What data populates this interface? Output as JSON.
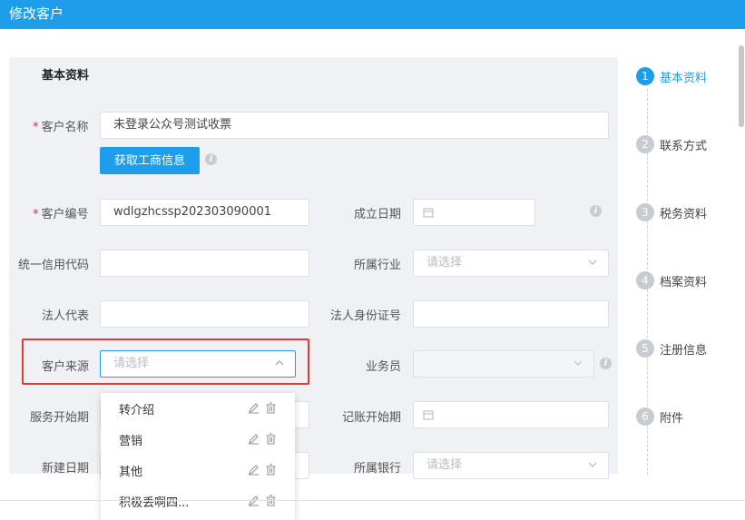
{
  "header": {
    "title": "修改客户"
  },
  "section": {
    "title": "基本资料"
  },
  "form": {
    "customer_name": {
      "label": "客户名称",
      "value": "未登录公众号测试收票"
    },
    "fetch_button": "获取工商信息",
    "customer_code": {
      "label": "客户编号",
      "value": "wdlgzhcssp202303090001"
    },
    "founded_date": {
      "label": "成立日期"
    },
    "credit_code": {
      "label": "统一信用代码"
    },
    "industry": {
      "label": "所属行业",
      "placeholder": "请选择"
    },
    "legal_rep": {
      "label": "法人代表"
    },
    "legal_id": {
      "label": "法人身份证号"
    },
    "source": {
      "label": "客户来源",
      "placeholder": "请选择"
    },
    "salesman": {
      "label": "业务员"
    },
    "service_start": {
      "label": "服务开始期"
    },
    "booking_start": {
      "label": "记账开始期"
    },
    "created_date": {
      "label": "新建日期"
    },
    "bank": {
      "label": "所属银行",
      "placeholder": "请选择"
    }
  },
  "source_dropdown": {
    "options": [
      "转介绍",
      "营销",
      "其他",
      "积极丢啊四..."
    ]
  },
  "steps": [
    {
      "num": "1",
      "label": "基本资料"
    },
    {
      "num": "2",
      "label": "联系方式"
    },
    {
      "num": "3",
      "label": "税务资料"
    },
    {
      "num": "4",
      "label": "档案资料"
    },
    {
      "num": "5",
      "label": "注册信息"
    },
    {
      "num": "6",
      "label": "附件"
    }
  ],
  "colors": {
    "accent": "#1e9eea",
    "highlight": "#e53935"
  },
  "icons": {
    "edit": "pencil-icon",
    "delete": "trash-icon",
    "date": "calendar-icon",
    "select": "chevron-down-icon",
    "info": "info-icon"
  }
}
